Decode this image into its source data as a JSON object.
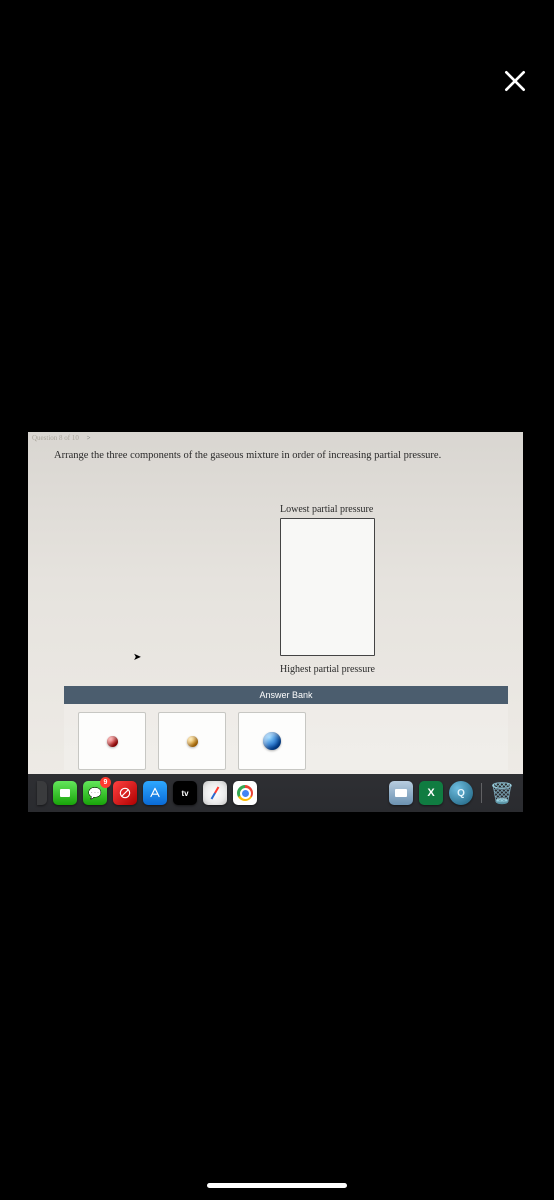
{
  "overlay": {
    "close_label": "Close"
  },
  "question": {
    "indicator": "Question 8 of 10",
    "arrow": ">",
    "prompt": "Arrange the three components of the gaseous mixture in order of increasing partial pressure.",
    "top_boundary_label": "Lowest partial pressure",
    "bottom_boundary_label": "Highest partial pressure",
    "bank_header": "Answer Bank",
    "bank_items": [
      {
        "name": "red-particle",
        "color": "red"
      },
      {
        "name": "orange-particle",
        "color": "orange"
      },
      {
        "name": "blue-particle",
        "color": "blue"
      }
    ]
  },
  "dock": {
    "apple_tv_label": "tv",
    "messages_badge": "9"
  }
}
